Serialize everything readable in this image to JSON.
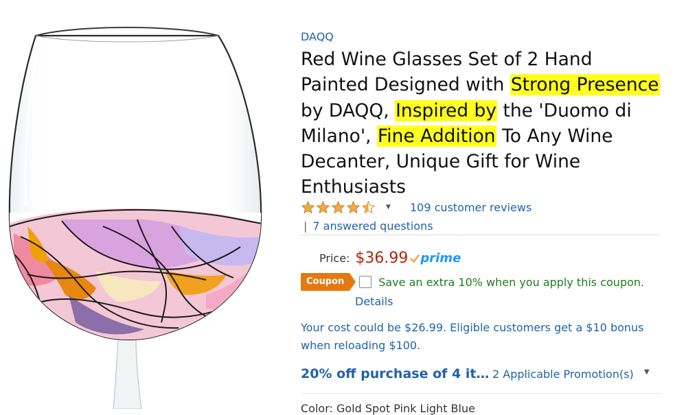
{
  "product": {
    "brand": "DAQQ",
    "title_parts": {
      "p1": "Red Wine Glasses Set of 2 Hand Painted Designed with ",
      "h1": "Strong Presence",
      "p2": " by DAQQ, ",
      "h2": "Inspired by",
      "p3": " the 'Duomo di Milano', ",
      "h3": "Fine Addition",
      "p4": " To Any Wine Decanter, Unique Gift for Wine Enthusiasts"
    },
    "highlight_color": "#ffff1f"
  },
  "rating": {
    "stars": 4.5,
    "reviews_label": "109 customer reviews",
    "answered_label": "7 answered questions",
    "pipe": "|"
  },
  "price": {
    "label": "Price:",
    "value": "$36.99",
    "prime_label": "prime",
    "price_color": "#b12704",
    "prime_color": "#1a98ff"
  },
  "coupon": {
    "badge_label": "Coupon",
    "text": "Save an extra 10% when you apply this coupon.",
    "details_label": "Details",
    "badge_color": "#e47911"
  },
  "your_cost": {
    "text": "Your cost could be $26.99. Eligible customers get a $10 bonus when reloading $100."
  },
  "promotion": {
    "headline": "20% off purchase of 4 it…",
    "applicable_label": "2 Applicable Promotion(s)"
  },
  "cut_off_row": {
    "text": "Color: Gold Spot Pink Light Blue"
  },
  "link_color": "#1f62a8"
}
